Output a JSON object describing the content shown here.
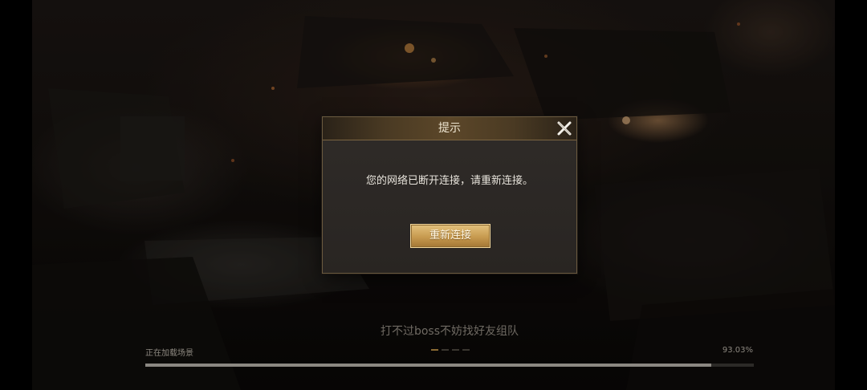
{
  "dialog": {
    "title": "提示",
    "message": "您的网络已断开连接，请重新连接。",
    "reconnect_label": "重新连接",
    "close_icon": "close-x-icon"
  },
  "loading": {
    "tip": "打不过boss不妨找好友组队",
    "label": "正在加载场景",
    "percent_text": "93.03%",
    "progress": 0.9303,
    "tip_page_count": 4,
    "tip_active_index": 0
  },
  "colors": {
    "accent_gold": "#c79a4f",
    "dialog_border": "#6b5a3f",
    "progress_fill": "#8b8882"
  }
}
